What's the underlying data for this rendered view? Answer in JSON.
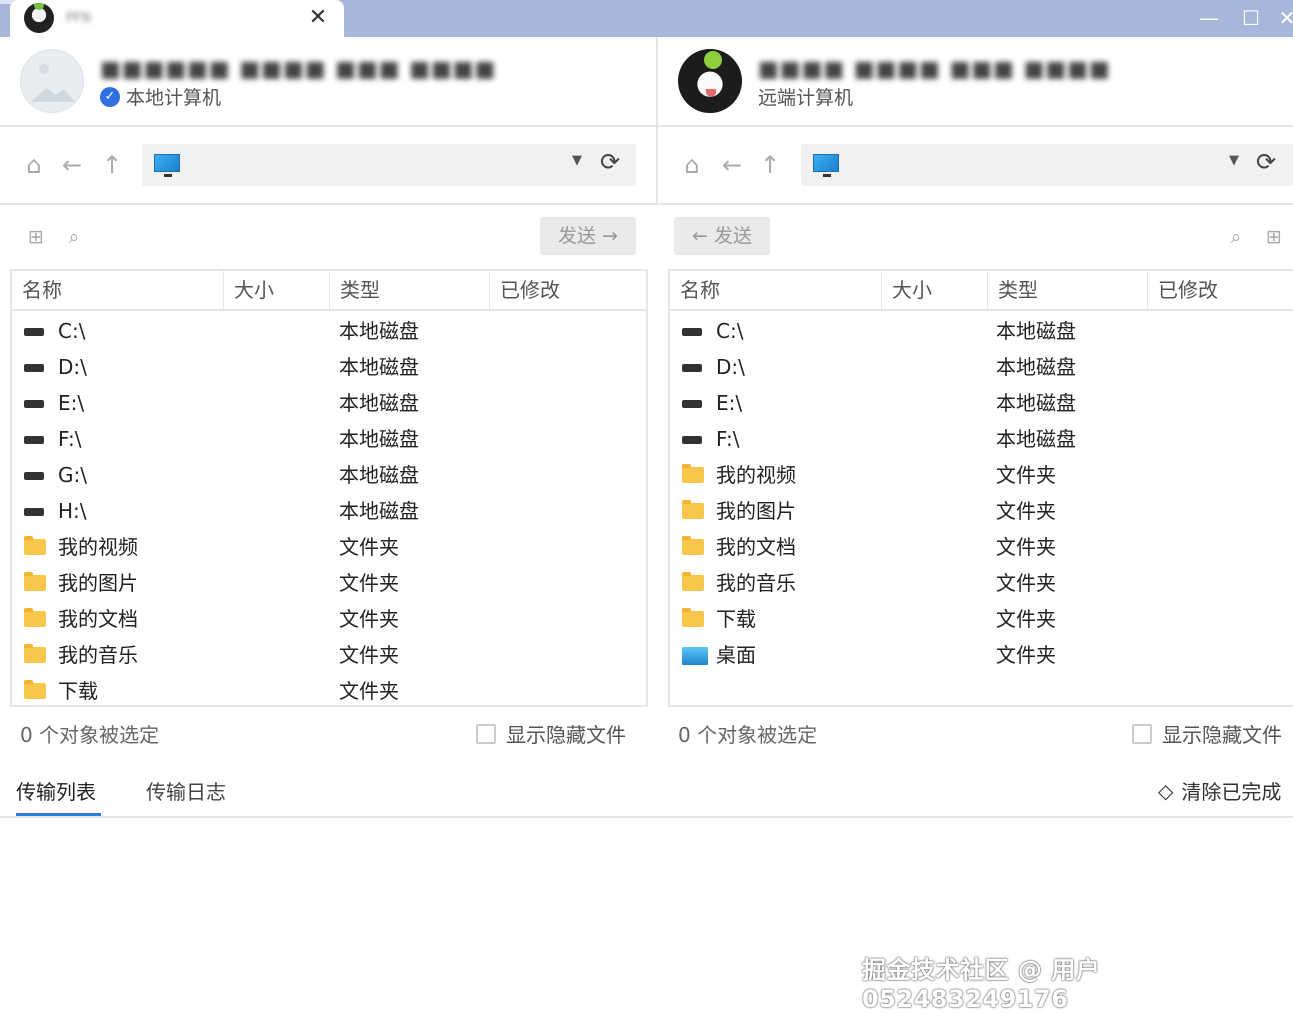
{
  "window": {
    "tab_title": "PFN",
    "tab_close": "✕",
    "minimize": "—",
    "maximize": "☐",
    "close": "✕"
  },
  "local": {
    "device_name": "■■■■■■ ■■■■ ■■■ ■■■■",
    "label": "本地计算机",
    "send_label": "发送",
    "columns": [
      "名称",
      "大小",
      "类型",
      "已修改"
    ],
    "rows": [
      {
        "icon": "drive",
        "name": "C:\\",
        "type": "本地磁盘"
      },
      {
        "icon": "drive",
        "name": "D:\\",
        "type": "本地磁盘"
      },
      {
        "icon": "drive",
        "name": "E:\\",
        "type": "本地磁盘"
      },
      {
        "icon": "drive",
        "name": "F:\\",
        "type": "本地磁盘"
      },
      {
        "icon": "drive",
        "name": "G:\\",
        "type": "本地磁盘"
      },
      {
        "icon": "drive",
        "name": "H:\\",
        "type": "本地磁盘"
      },
      {
        "icon": "folder",
        "name": "我的视频",
        "type": "文件夹"
      },
      {
        "icon": "folder",
        "name": "我的图片",
        "type": "文件夹"
      },
      {
        "icon": "folder",
        "name": "我的文档",
        "type": "文件夹"
      },
      {
        "icon": "folder",
        "name": "我的音乐",
        "type": "文件夹"
      },
      {
        "icon": "folder",
        "name": "下载",
        "type": "文件夹"
      }
    ],
    "selection": "0 个对象被选定",
    "show_hidden": "显示隐藏文件"
  },
  "remote": {
    "device_name": "■■■■ ■■■■ ■■■ ■■■■",
    "label": "远端计算机",
    "send_label": "发送",
    "columns": [
      "名称",
      "大小",
      "类型",
      "已修改"
    ],
    "rows": [
      {
        "icon": "drive",
        "name": "C:\\",
        "type": "本地磁盘"
      },
      {
        "icon": "drive",
        "name": "D:\\",
        "type": "本地磁盘"
      },
      {
        "icon": "drive",
        "name": "E:\\",
        "type": "本地磁盘"
      },
      {
        "icon": "drive",
        "name": "F:\\",
        "type": "本地磁盘"
      },
      {
        "icon": "folder",
        "name": "我的视频",
        "type": "文件夹"
      },
      {
        "icon": "folder",
        "name": "我的图片",
        "type": "文件夹"
      },
      {
        "icon": "folder",
        "name": "我的文档",
        "type": "文件夹"
      },
      {
        "icon": "folder",
        "name": "我的音乐",
        "type": "文件夹"
      },
      {
        "icon": "folder",
        "name": "下载",
        "type": "文件夹"
      },
      {
        "icon": "desktop",
        "name": "桌面",
        "type": "文件夹"
      }
    ],
    "selection": "0 个对象被选定",
    "show_hidden": "显示隐藏文件"
  },
  "bottom": {
    "tab_transfer_list": "传输列表",
    "tab_transfer_log": "传输日志",
    "clear_done": "清除已完成"
  },
  "watermark": "掘金技术社区 @ 用户052483249176",
  "colors": {
    "titlebar": "#a9b6dc",
    "accent": "#2f7be0",
    "folder": "#f7c64a"
  }
}
